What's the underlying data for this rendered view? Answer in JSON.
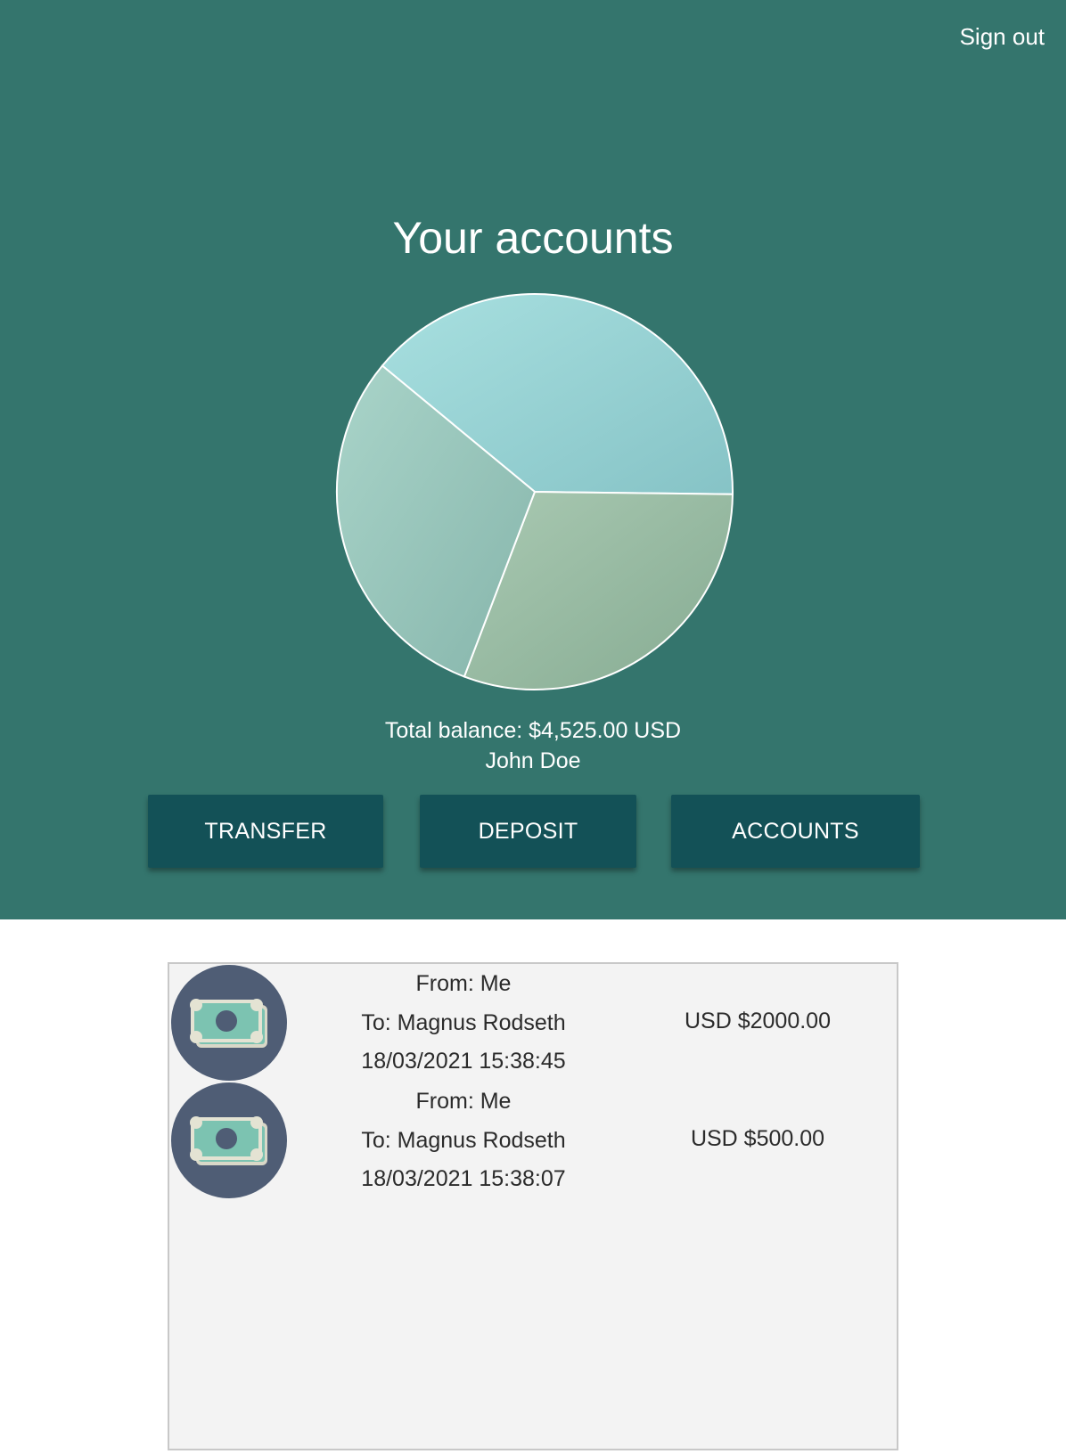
{
  "header": {
    "sign_out_label": "Sign out",
    "title": "Your accounts",
    "total_balance": "Total balance: $4,525.00 USD",
    "user_name": "John Doe",
    "background_color": "#34756d"
  },
  "chart_data": {
    "type": "pie",
    "slices": [
      {
        "value": 0.392,
        "color": "#92cecd"
      },
      {
        "value": 0.306,
        "color": "#9dbba2"
      },
      {
        "value": 0.302,
        "color": "#9ec6bc"
      }
    ]
  },
  "actions": {
    "transfer_label": "TRANSFER",
    "deposit_label": "DEPOSIT",
    "accounts_label": "ACCOUNTS",
    "button_color": "#135157"
  },
  "transactions": [
    {
      "icon": "money-icon",
      "from": "From: Me",
      "to": "To: Magnus Rodseth",
      "date": "18/03/2021 15:38:45",
      "amount": "USD $2000.00"
    },
    {
      "icon": "money-icon",
      "from": "From: Me",
      "to": "To: Magnus Rodseth",
      "date": "18/03/2021 15:38:07",
      "amount": "USD $500.00"
    }
  ]
}
